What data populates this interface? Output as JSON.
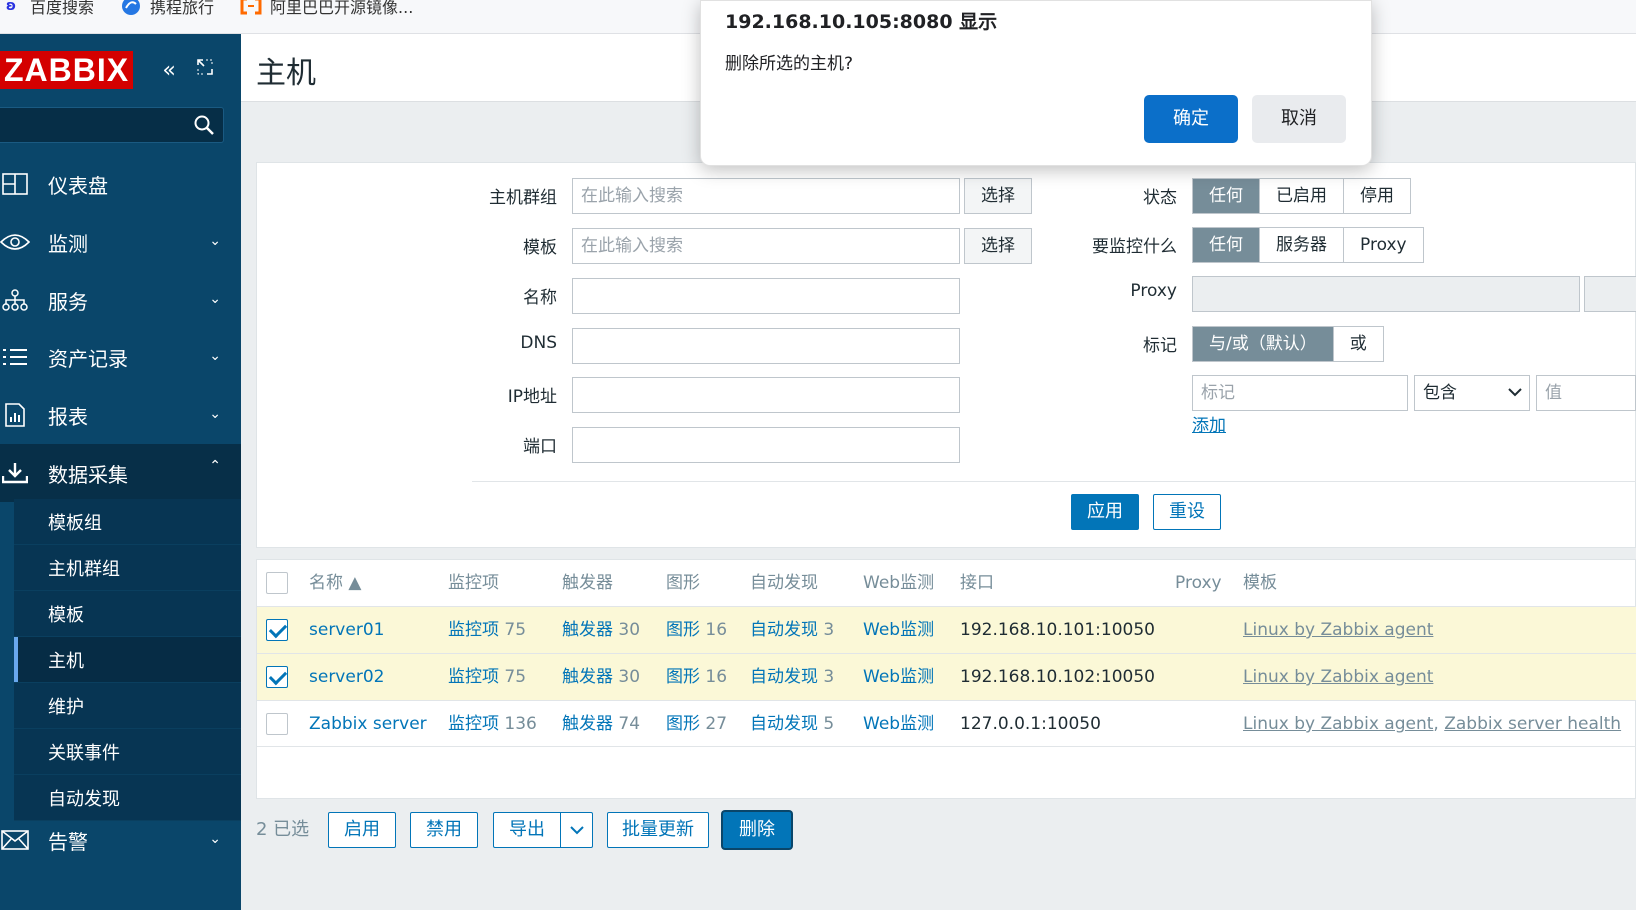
{
  "bookmarks": [
    {
      "icon": "baidu-paw-icon",
      "label": "百度搜索"
    },
    {
      "icon": "ctrip-icon",
      "label": "携程旅行"
    },
    {
      "icon": "aliyun-icon",
      "label": "阿里巴巴开源镜像..."
    }
  ],
  "sidebar": {
    "logo": "ZABBIX",
    "items": [
      {
        "label": "仪表盘",
        "icon": "dashboard-icon"
      },
      {
        "label": "监测",
        "icon": "eye-icon"
      },
      {
        "label": "服务",
        "icon": "services-tree-icon"
      },
      {
        "label": "资产记录",
        "icon": "list-icon"
      },
      {
        "label": "报表",
        "icon": "report-icon"
      },
      {
        "label": "数据采集",
        "icon": "download-icon"
      },
      {
        "label": "告警",
        "icon": "envelope-icon"
      }
    ],
    "subitems": [
      "模板组",
      "主机群组",
      "模板",
      "主机",
      "维护",
      "关联事件",
      "自动发现"
    ]
  },
  "page": {
    "title": "主机"
  },
  "filter": {
    "host_group_label": "主机群组",
    "template_label": "模板",
    "name_label": "名称",
    "dns_label": "DNS",
    "ip_label": "IP地址",
    "port_label": "端口",
    "search_placeholder": "在此输入搜索",
    "select_label": "选择",
    "status_label": "状态",
    "status_options": [
      "任何",
      "已启用",
      "停用"
    ],
    "monitored_by_label": "要监控什么",
    "monitored_by_options": [
      "任何",
      "服务器",
      "Proxy"
    ],
    "proxy_label": "Proxy",
    "tags_label": "标记",
    "tags_options": [
      "与/或（默认）",
      "或"
    ],
    "tag_placeholder": "标记",
    "tag_operator": "包含",
    "tag_value_placeholder": "值",
    "add_label": "添加",
    "apply_label": "应用",
    "reset_label": "重设"
  },
  "table": {
    "headers": [
      "名称 ▲",
      "监控项",
      "触发器",
      "图形",
      "自动发现",
      "Web监测",
      "接口",
      "Proxy",
      "模板"
    ],
    "rows": [
      {
        "selected": true,
        "name": "server01",
        "items": "监控项",
        "items_count": "75",
        "triggers": "触发器",
        "triggers_count": "30",
        "graphs": "图形",
        "graphs_count": "16",
        "discovery": "自动发现",
        "discovery_count": "3",
        "web": "Web监测",
        "interface": "192.168.10.101:10050",
        "proxy": "",
        "templates": "Linux by Zabbix agent"
      },
      {
        "selected": true,
        "name": "server02",
        "items": "监控项",
        "items_count": "75",
        "triggers": "触发器",
        "triggers_count": "30",
        "graphs": "图形",
        "graphs_count": "16",
        "discovery": "自动发现",
        "discovery_count": "3",
        "web": "Web监测",
        "interface": "192.168.10.102:10050",
        "proxy": "",
        "templates": "Linux by Zabbix agent"
      },
      {
        "selected": false,
        "name": "Zabbix server",
        "items": "监控项",
        "items_count": "136",
        "triggers": "触发器",
        "triggers_count": "74",
        "graphs": "图形",
        "graphs_count": "27",
        "discovery": "自动发现",
        "discovery_count": "5",
        "web": "Web监测",
        "interface": "127.0.0.1:10050",
        "proxy": "",
        "templates": "Linux by Zabbix agent",
        "templates_2": "Zabbix server health"
      }
    ]
  },
  "footer": {
    "selected_count": "2 已选",
    "enable": "启用",
    "disable": "禁用",
    "export": "导出",
    "mass_update": "批量更新",
    "delete": "删除"
  },
  "dialog": {
    "title": "192.168.10.105:8080 显示",
    "message": "删除所选的主机?",
    "ok": "确定",
    "cancel": "取消"
  },
  "colors": {
    "sidebar": "#0a466a",
    "accent": "#0275b8",
    "logo": "#d40000",
    "selected_row": "#fbf8d7"
  }
}
